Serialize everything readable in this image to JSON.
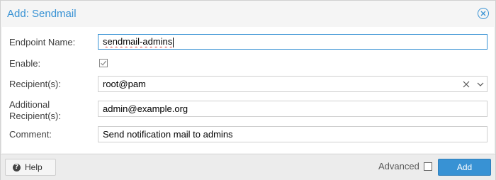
{
  "dialog": {
    "title": "Add: Sendmail",
    "close_icon": "close-circle-icon"
  },
  "form": {
    "endpoint_name": {
      "label": "Endpoint Name:",
      "value": "sendmail-admins"
    },
    "enable": {
      "label": "Enable:",
      "checked": true
    },
    "recipients": {
      "label": "Recipient(s):",
      "value": "root@pam",
      "clear_icon": "clear-x-icon",
      "dropdown_icon": "chevron-down-icon"
    },
    "additional_recipients": {
      "label_line1": "Additional",
      "label_line2": "Recipient(s):",
      "value": "admin@example.org"
    },
    "comment": {
      "label": "Comment:",
      "value": "Send notification mail to admins"
    }
  },
  "footer": {
    "help_label": "Help",
    "advanced_label": "Advanced",
    "advanced_checked": false,
    "add_label": "Add"
  },
  "colors": {
    "accent": "#3892d4"
  }
}
